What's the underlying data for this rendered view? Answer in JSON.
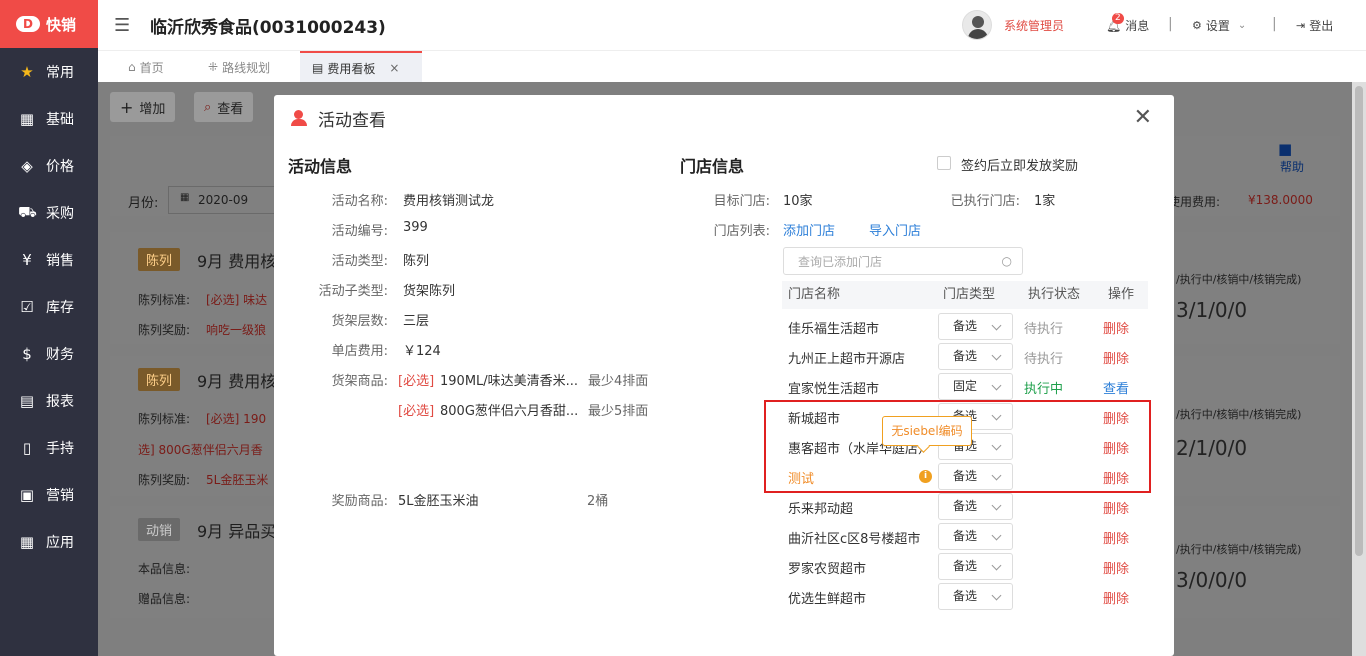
{
  "app": {
    "brand": "快销",
    "brand_color": "#f04b47"
  },
  "sidebar": {
    "items": [
      {
        "label": "常用",
        "icon": "star-icon",
        "glyph": "★"
      },
      {
        "label": "基础",
        "icon": "grid-icon",
        "glyph": "▦"
      },
      {
        "label": "价格",
        "icon": "tag-icon",
        "glyph": "◈"
      },
      {
        "label": "采购",
        "icon": "cart-icon",
        "glyph": "⛟"
      },
      {
        "label": "销售",
        "icon": "yen-icon",
        "glyph": "¥"
      },
      {
        "label": "库存",
        "icon": "checkbox-icon",
        "glyph": "☑"
      },
      {
        "label": "财务",
        "icon": "money-bag-icon",
        "glyph": "$"
      },
      {
        "label": "报表",
        "icon": "report-icon",
        "glyph": "▤"
      },
      {
        "label": "手持",
        "icon": "handheld-icon",
        "glyph": "▯"
      },
      {
        "label": "营销",
        "icon": "marketing-icon",
        "glyph": "▣"
      },
      {
        "label": "应用",
        "icon": "apps-icon",
        "glyph": "▦"
      }
    ]
  },
  "header": {
    "title": "临沂欣秀食品(0031000243)",
    "user": "系统管理员",
    "messages_label": "消息",
    "messages_count": "2",
    "settings_label": "设置",
    "logout_label": "登出"
  },
  "tabs": [
    {
      "label": "首页"
    },
    {
      "label": "路线规划"
    },
    {
      "label": "费用看板"
    }
  ],
  "background": {
    "add_label": "增加",
    "view_label": "查看",
    "help_label": "帮助",
    "month_label": "月份:",
    "month_value": "2020-09",
    "used_cost_label": "使用费用:",
    "used_cost_value": "¥138.0000",
    "cards": [
      {
        "tag": "陈列",
        "title": "9月 费用核",
        "line1_label": "陈列标准:",
        "line1_value": "[必选] 味达",
        "line2_label": "陈列奖励:",
        "line2_value": "响吃一级狼",
        "status_hint": "/执行中/核销中/核销完成)",
        "status_value": "3/1/0/0"
      },
      {
        "tag": "陈列",
        "title": "9月 费用核",
        "line1_label": "陈列标准:",
        "line1_value": "[必选] 190",
        "line2_label": "选] 800G葱伴侣六月香",
        "line2_value": "",
        "line3_label": "陈列奖励:",
        "line3_value": "5L金胚玉米",
        "status_hint": "/执行中/核销中/核销完成)",
        "status_value": "2/1/0/0"
      },
      {
        "tag": "动销",
        "title": "9月 异品买",
        "line1_label": "本品信息:",
        "line2_label": "赠品信息:",
        "status_hint": "/执行中/核销中/核销完成)",
        "status_value": "3/0/0/0"
      }
    ]
  },
  "modal": {
    "title": "活动查看",
    "activity": {
      "section_title": "活动信息",
      "fields": [
        {
          "label": "活动名称:",
          "value": "费用核销测试龙"
        },
        {
          "label": "活动编号:",
          "value": "399"
        },
        {
          "label": "活动类型:",
          "value": "陈列"
        },
        {
          "label": "活动子类型:",
          "value": "货架陈列"
        },
        {
          "label": "货架层数:",
          "value": "三层"
        },
        {
          "label": "单店费用:",
          "value": "￥124"
        }
      ],
      "shelf_label": "货架商品:",
      "shelf_items": [
        {
          "req": "[必选]",
          "name": "190ML/味达美清香米...",
          "qty": "最少4排面"
        },
        {
          "req": "[必选]",
          "name": "800G葱伴侣六月香甜...",
          "qty": "最少5排面"
        }
      ],
      "reward_label": "奖励商品:",
      "reward_name": "5L金胚玉米油",
      "reward_qty": "2桶"
    },
    "store": {
      "section_title": "门店信息",
      "sign_reward_label": "签约后立即发放奖励",
      "target_label": "目标门店:",
      "target_value": "10家",
      "executed_label": "已执行门店:",
      "executed_value": "1家",
      "list_label": "门店列表:",
      "add_store": "添加门店",
      "import_store": "导入门店",
      "search_placeholder": "查询已添加门店",
      "columns": [
        "门店名称",
        "门店类型",
        "执行状态",
        "操作"
      ],
      "rows": [
        {
          "name": "佳乐福生活超市",
          "type": "备选",
          "status": "待执行",
          "action": "删除"
        },
        {
          "name": "九州正上超市开源店",
          "type": "备选",
          "status": "待执行",
          "action": "删除"
        },
        {
          "name": "宜家悦生活超市",
          "type": "固定",
          "status": "执行中",
          "action": "查看"
        },
        {
          "name": "新城超市",
          "type": "备选",
          "status": "",
          "action": "删除"
        },
        {
          "name": "惠客超市（水岸华庭店）",
          "type": "备选",
          "status": "",
          "action": "删除"
        },
        {
          "name": "测试",
          "type": "备选",
          "status": "",
          "action": "删除"
        },
        {
          "name": "乐来邦动超",
          "type": "备选",
          "status": "",
          "action": "删除"
        },
        {
          "name": "曲沂社区c区8号楼超市",
          "type": "备选",
          "status": "",
          "action": "删除"
        },
        {
          "name": "罗家农贸超市",
          "type": "备选",
          "status": "",
          "action": "删除"
        },
        {
          "name": "优选生鲜超市",
          "type": "备选",
          "status": "",
          "action": "删除"
        }
      ],
      "tooltip": "无siebel编码"
    }
  }
}
